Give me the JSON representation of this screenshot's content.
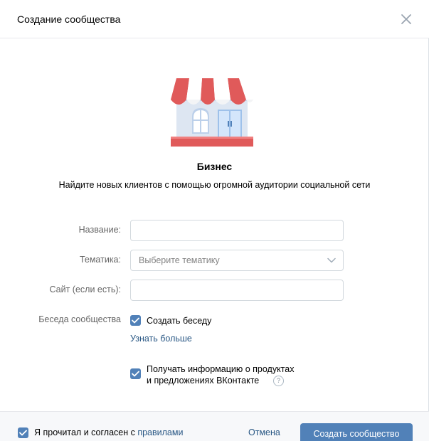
{
  "header": {
    "title": "Создание сообщества"
  },
  "community_type": {
    "title": "Бизнес",
    "description": "Найдите новых клиентов с помощью огромной аудитории социальной сети"
  },
  "form": {
    "name_label": "Название:",
    "name_value": "",
    "theme_label": "Тематика:",
    "theme_placeholder": "Выберите тематику",
    "site_label": "Сайт (если есть):",
    "site_value": "",
    "chat_label": "Беседа сообщества",
    "chat_checkbox_label": "Создать беседу",
    "chat_checked": true,
    "learn_more": "Узнать больше",
    "news_checkbox_line1": "Получать информацию о продуктах",
    "news_checkbox_line2": "и предложениях ВКонтакте",
    "news_checked": true,
    "help_glyph": "?"
  },
  "footer": {
    "agree_text": "Я прочитал и согласен с ",
    "rules_link": "правилами",
    "agree_checked": true,
    "cancel_label": "Отмена",
    "create_label": "Создать сообщество"
  },
  "colors": {
    "accent": "#5181b8",
    "link": "#2a5885",
    "awning_red": "#e05a5a"
  },
  "icons": [
    "close-icon",
    "store-illustration",
    "chevron-down-icon",
    "checkmark-icon",
    "help-icon"
  ]
}
